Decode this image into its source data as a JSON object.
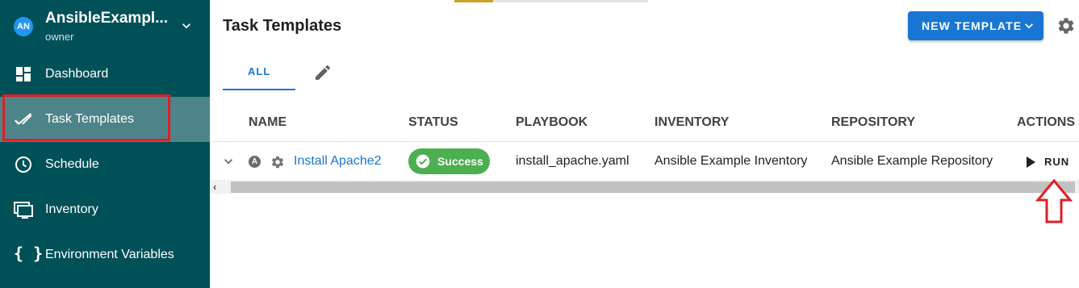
{
  "sidebar": {
    "project": {
      "avatar": "AN",
      "name": "AnsibleExampl...",
      "role": "owner"
    },
    "items": [
      {
        "label": "Dashboard",
        "icon": "dashboard-icon"
      },
      {
        "label": "Task Templates",
        "icon": "double-check-icon",
        "active": true
      },
      {
        "label": "Schedule",
        "icon": "clock-icon"
      },
      {
        "label": "Inventory",
        "icon": "monitor-icon"
      },
      {
        "label": "Environment Variables",
        "icon": "curly-braces-icon",
        "glyph": "{ }"
      }
    ]
  },
  "header": {
    "title": "Task Templates",
    "new_template_label": "NEW TEMPLATE",
    "settings_icon": "gear-icon"
  },
  "tabs": [
    {
      "label": "ALL",
      "active": true
    }
  ],
  "table": {
    "columns": [
      "NAME",
      "STATUS",
      "PLAYBOOK",
      "INVENTORY",
      "REPOSITORY",
      "ACTIONS"
    ],
    "rows": [
      {
        "name": "Install Apache2",
        "status": "Success",
        "playbook": "install_apache.yaml",
        "inventory": "Ansible Example Inventory",
        "repository": "Ansible Example Repository",
        "action": "RUN"
      }
    ]
  },
  "colors": {
    "sidebar_bg": "#005057",
    "sidebar_active": "#4d8489",
    "primary": "#1976d2",
    "success": "#4caf50",
    "annotation_red": "#e01e25"
  }
}
